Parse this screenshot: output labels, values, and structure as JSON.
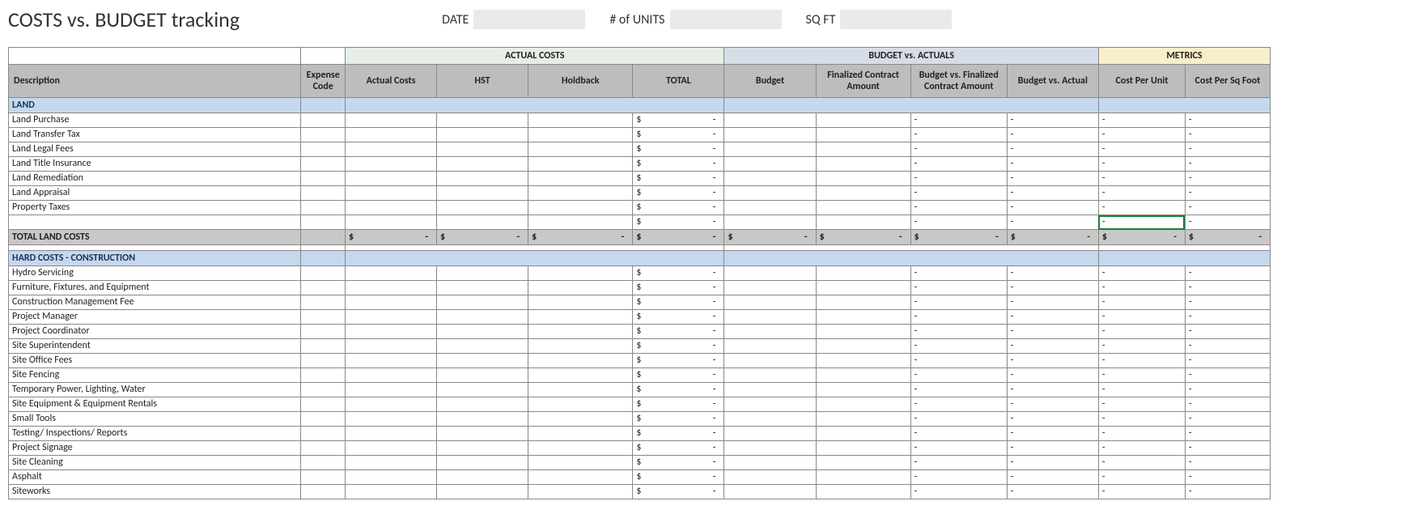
{
  "title": "COSTS vs. BUDGET tracking",
  "fields": {
    "date_label": "DATE",
    "date_value": "",
    "units_label": "# of UNITS",
    "units_value": "",
    "sqft_label": "SQ FT",
    "sqft_value": ""
  },
  "groups": {
    "actual": "ACTUAL COSTS",
    "bva": "BUDGET vs. ACTUALS",
    "metrics": "METRICS"
  },
  "columns": {
    "description": "Description",
    "expense_code": "Expense Code",
    "actual_costs": "Actual Costs",
    "hst": "HST",
    "holdback": "Holdback",
    "total": "TOTAL",
    "budget": "Budget",
    "final_contract": "Finalized Contract Amount",
    "bvs_final": "Budget vs. Finalized Contract Amount",
    "bvs_actual": "Budget vs. Actual",
    "cpu": "Cost Per Unit",
    "cpsf": "Cost Per Sq Foot"
  },
  "sections": [
    {
      "title": "LAND",
      "rows": [
        {
          "desc": "Land Purchase"
        },
        {
          "desc": "Land Transfer Tax"
        },
        {
          "desc": "Land Legal Fees"
        },
        {
          "desc": "Land Title Insurance"
        },
        {
          "desc": "Land Remediation"
        },
        {
          "desc": "Land Appraisal"
        },
        {
          "desc": "Property Taxes"
        },
        {
          "desc": ""
        }
      ],
      "total_label": "TOTAL LAND COSTS"
    },
    {
      "title": "HARD COSTS - CONSTRUCTION",
      "rows": [
        {
          "desc": "Hydro Servicing"
        },
        {
          "desc": "Furniture, Fixtures, and Equipment"
        },
        {
          "desc": "Construction Management Fee"
        },
        {
          "desc": "Project Manager"
        },
        {
          "desc": "Project Coordinator"
        },
        {
          "desc": "Site Superintendent"
        },
        {
          "desc": "Site Office Fees"
        },
        {
          "desc": "Site Fencing"
        },
        {
          "desc": "Temporary Power, Lighting, Water"
        },
        {
          "desc": "Site Equipment & Equipment Rentals"
        },
        {
          "desc": "Small Tools"
        },
        {
          "desc": "Testing/ Inspections/ Reports"
        },
        {
          "desc": "Project Signage"
        },
        {
          "desc": "Site Cleaning"
        },
        {
          "desc": "Asphalt"
        },
        {
          "desc": "Siteworks"
        }
      ]
    }
  ],
  "glyphs": {
    "dash": "-",
    "dollar": "$"
  }
}
